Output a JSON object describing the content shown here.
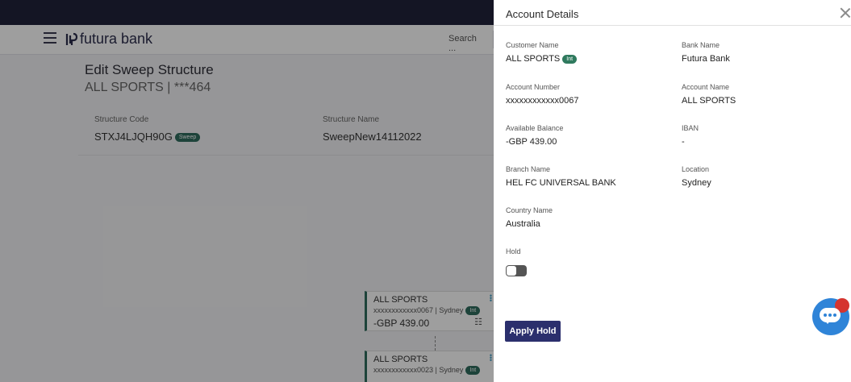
{
  "header": {
    "brand": "futura bank",
    "search_placeholder": "Search ..."
  },
  "page": {
    "title": "Edit Sweep Structure",
    "subtitle": "ALL SPORTS | ***464",
    "structure_code_label": "Structure Code",
    "structure_code": "STXJ4LJQH90G",
    "structure_code_badge": "Sweep",
    "structure_name_label": "Structure Name",
    "structure_name": "SweepNew14112022"
  },
  "nodes": [
    {
      "name": "ALL SPORTS",
      "meta": "xxxxxxxxxxxx0067 | Sydney",
      "badge": "Int",
      "balance": "-GBP 439.00"
    },
    {
      "name": "ALL SPORTS",
      "meta": "xxxxxxxxxxxx0023 | Sydney",
      "badge": "Int"
    }
  ],
  "drawer": {
    "title": "Account Details",
    "customer_name_label": "Customer Name",
    "customer_name": "ALL SPORTS",
    "customer_badge": "Int",
    "bank_name_label": "Bank Name",
    "bank_name": "Futura Bank",
    "account_number_label": "Account Number",
    "account_number": "xxxxxxxxxxxx0067",
    "account_name_label": "Account Name",
    "account_name": "ALL SPORTS",
    "available_balance_label": "Available Balance",
    "available_balance": "-GBP 439.00",
    "iban_label": "IBAN",
    "iban": "-",
    "branch_name_label": "Branch Name",
    "branch_name": "HEL FC UNIVERSAL BANK",
    "location_label": "Location",
    "location": "Sydney",
    "country_name_label": "Country Name",
    "country_name": "Australia",
    "hold_label": "Hold",
    "hold_on": false,
    "apply_hold_label": "Apply Hold"
  },
  "colors": {
    "topbar": "#21223b",
    "primary_button": "#2b2f6d",
    "badge_green": "#2f7a5e",
    "chat_blue": "#2f84d8"
  }
}
